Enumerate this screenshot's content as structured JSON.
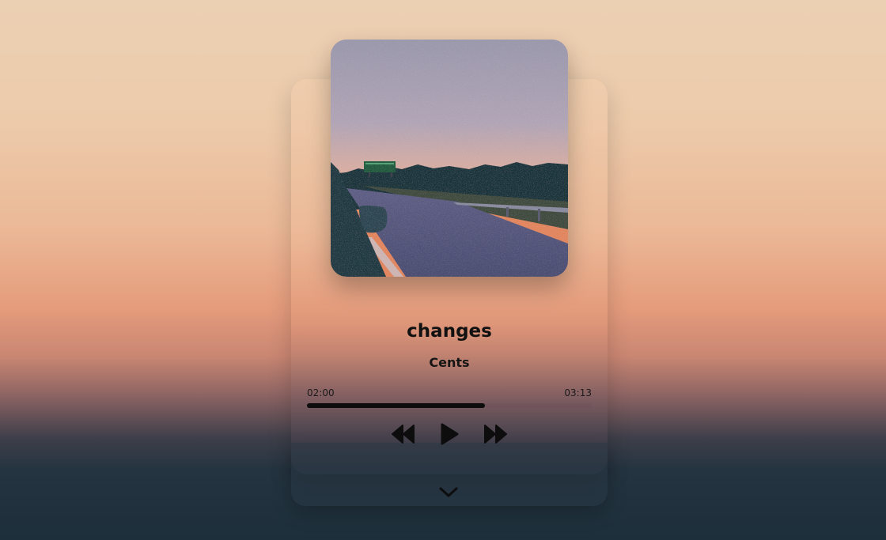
{
  "player": {
    "track_title": "changes",
    "artist": "Cents",
    "current_time": "02:00",
    "total_time": "03:13",
    "progress": 0.625
  },
  "controls": {
    "previous_icon": "rewind-icon",
    "play_icon": "play-icon",
    "next_icon": "fast-forward-icon",
    "drawer_icon": "chevron-down-icon"
  },
  "colors": {
    "progress_fill": "#0d0d0d",
    "text": "#111111"
  }
}
